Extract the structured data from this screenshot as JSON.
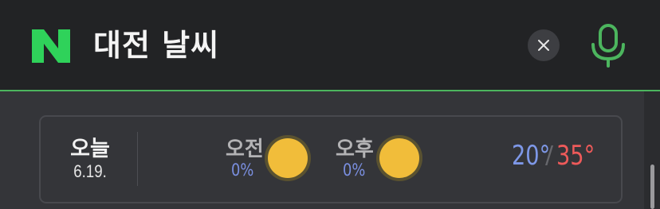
{
  "header": {
    "logo_letter": "N",
    "query": "대전 날씨",
    "clear_icon": "close-icon",
    "mic_icon": "microphone-icon",
    "accent_color": "#4cb55e"
  },
  "weather": {
    "day": {
      "label": "오늘",
      "date": "6.19."
    },
    "morning": {
      "label": "오전",
      "rain": "0%",
      "icon": "sun-icon"
    },
    "afternoon": {
      "label": "오후",
      "rain": "0%",
      "icon": "sun-icon"
    },
    "temp_low": "20°",
    "temp_separator": "/",
    "temp_high": "35°",
    "low_color": "#7e98e8",
    "high_color": "#ee5a5a"
  }
}
